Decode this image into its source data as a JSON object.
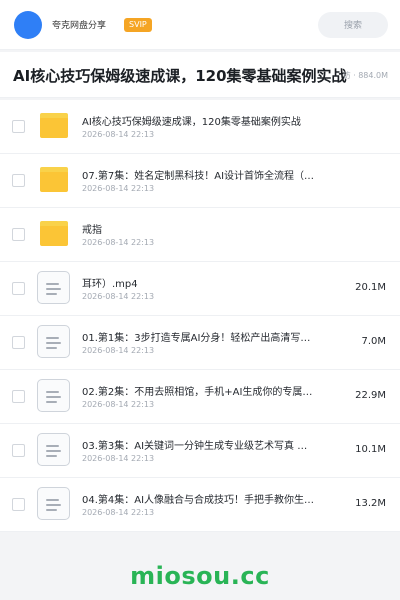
{
  "header": {
    "site_name": "夸克网盘分享",
    "badge": "SVIP",
    "search_placeholder": "搜索"
  },
  "title_bar": {
    "title": "AI核心技巧保姆级速成课，120集零基础案例实战",
    "meta": "访 · 884.0M"
  },
  "files": [
    {
      "type": "folder",
      "name": "AI核心技巧保姆级速成课，120集零基础案例实战",
      "date": "2026-08-14 22:13",
      "size": ""
    },
    {
      "type": "folder",
      "name": "07.第7集：姓名定制黑科技！AI设计首饰全流程（…",
      "date": "2026-08-14 22:13",
      "size": ""
    },
    {
      "type": "folder",
      "name": "戒指",
      "date": "2026-08-14 22:13",
      "size": ""
    },
    {
      "type": "file",
      "name": "耳环）.mp4",
      "date": "2026-08-14 22:13",
      "size": "20.1M"
    },
    {
      "type": "file",
      "name": "01.第1集：3步打造专属AI分身！轻松产出高清写…",
      "date": "2026-08-14 22:13",
      "size": "7.0M"
    },
    {
      "type": "file",
      "name": "02.第2集：不用去照相馆，手机+AI生成你的专属…",
      "date": "2026-08-14 22:13",
      "size": "22.9M"
    },
    {
      "type": "file",
      "name": "03.第3集：AI关键词一分钟生成专业级艺术写真 …",
      "date": "2026-08-14 22:13",
      "size": "10.1M"
    },
    {
      "type": "file",
      "name": "04.第4集：AI人像融合与合成技巧！手把手教你生…",
      "date": "2026-08-14 22:13",
      "size": "13.2M"
    }
  ],
  "watermark": "miosou.cc",
  "colors": {
    "accent": "#2f7ff6",
    "badge": "#f5a524",
    "folder": "#fbc536",
    "watermark": "#29b456"
  },
  "icons": {
    "folder": "folder-icon",
    "file": "document-icon"
  }
}
